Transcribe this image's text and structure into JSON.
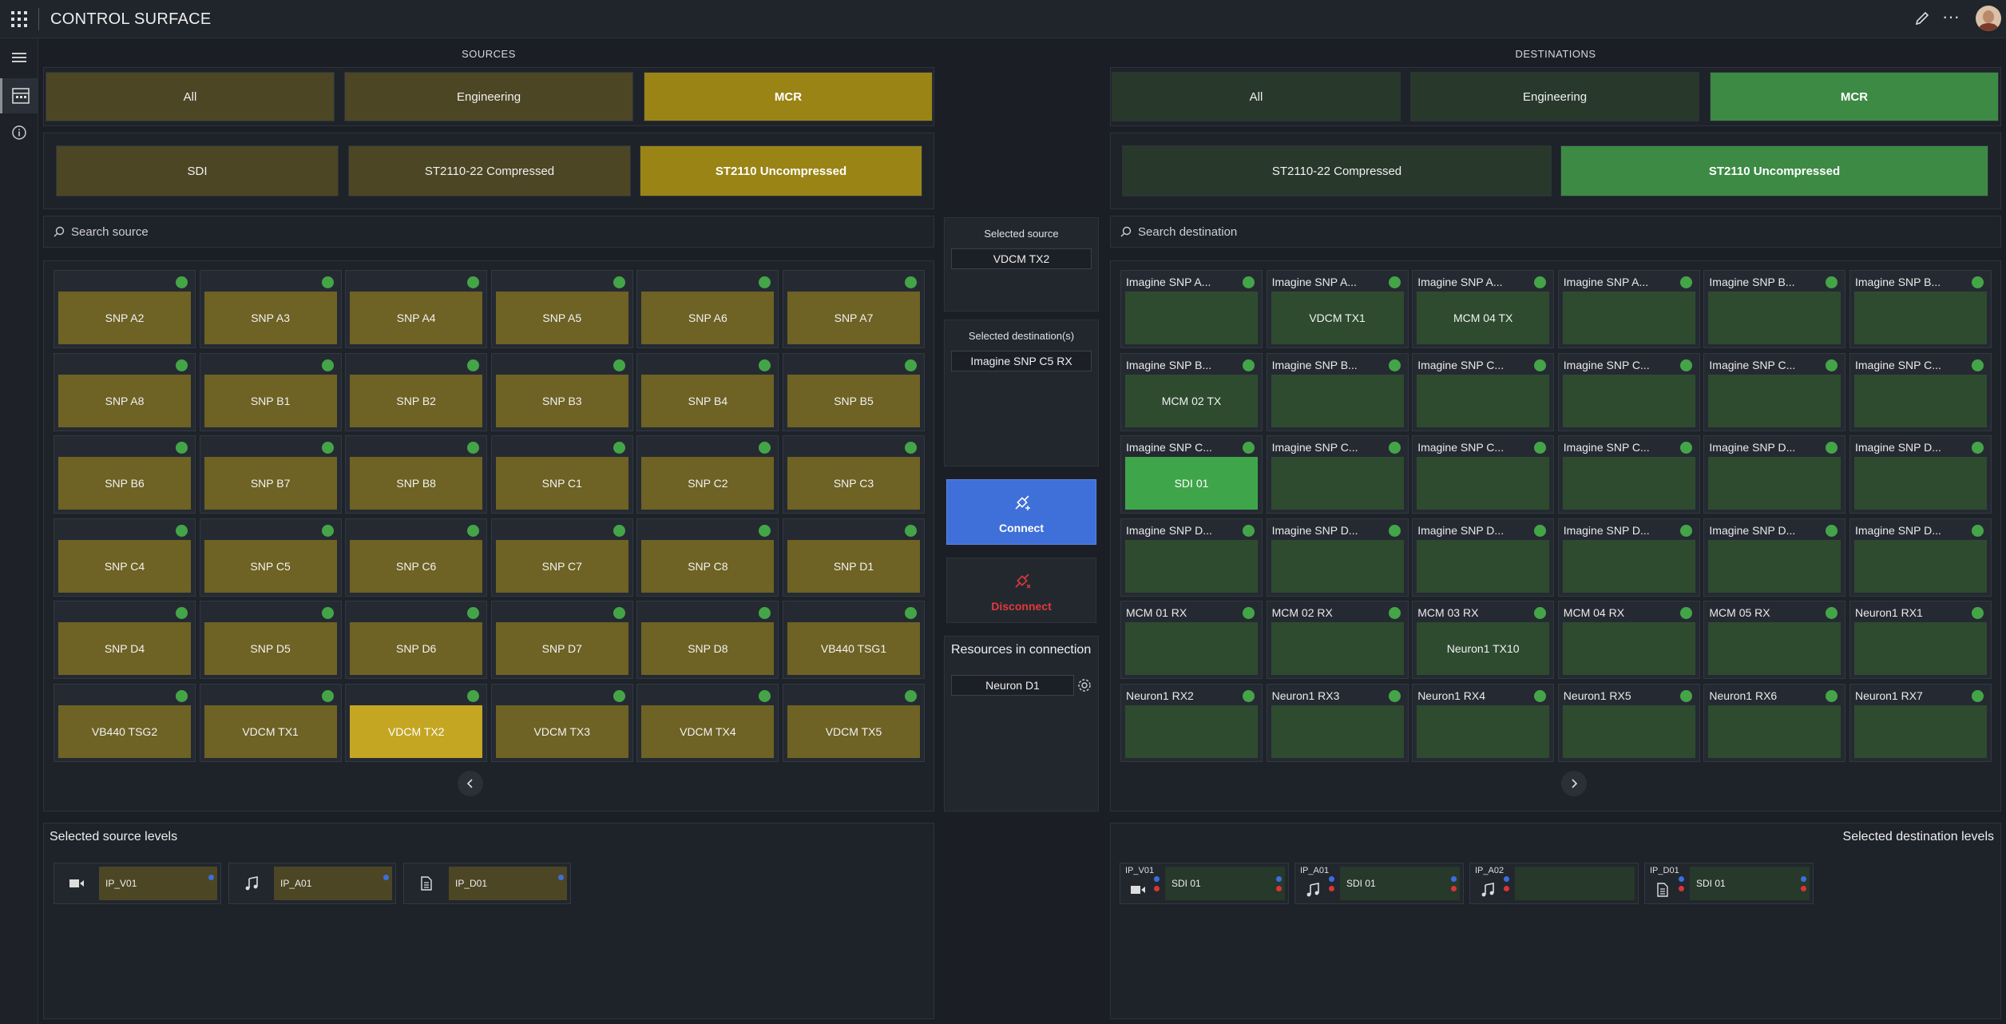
{
  "app": {
    "title": "CONTROL SURFACE"
  },
  "sections": {
    "sources": "SOURCES",
    "destinations": "DESTINATIONS"
  },
  "sources": {
    "groups": [
      "All",
      "Engineering",
      "MCR"
    ],
    "types": [
      "SDI",
      "ST2110-22 Compressed",
      "ST2110 Uncompressed"
    ],
    "search_placeholder": "Search source",
    "tiles": [
      "SNP A2",
      "SNP A3",
      "SNP A4",
      "SNP A5",
      "SNP A6",
      "SNP A7",
      "SNP A8",
      "SNP B1",
      "SNP B2",
      "SNP B3",
      "SNP B4",
      "SNP B5",
      "SNP B6",
      "SNP B7",
      "SNP B8",
      "SNP C1",
      "SNP C2",
      "SNP C3",
      "SNP C4",
      "SNP C5",
      "SNP C6",
      "SNP C7",
      "SNP C8",
      "SNP D1",
      "SNP D4",
      "SNP D5",
      "SNP D6",
      "SNP D7",
      "SNP D8",
      "VB440 TSG1",
      "VB440 TSG2",
      "VDCM TX1",
      "VDCM TX2",
      "VDCM TX3",
      "VDCM TX4",
      "VDCM TX5"
    ]
  },
  "destinations": {
    "groups": [
      "All",
      "Engineering",
      "MCR"
    ],
    "types": [
      "ST2110-22 Compressed",
      "ST2110 Uncompressed"
    ],
    "search_placeholder": "Search destination",
    "tiles": [
      {
        "name": "Imagine SNP A...",
        "value": ""
      },
      {
        "name": "Imagine SNP A...",
        "value": "VDCM TX1"
      },
      {
        "name": "Imagine SNP A...",
        "value": "MCM 04 TX"
      },
      {
        "name": "Imagine SNP A...",
        "value": ""
      },
      {
        "name": "Imagine SNP B...",
        "value": ""
      },
      {
        "name": "Imagine SNP B...",
        "value": ""
      },
      {
        "name": "Imagine SNP B...",
        "value": "MCM 02 TX"
      },
      {
        "name": "Imagine SNP B...",
        "value": ""
      },
      {
        "name": "Imagine SNP C...",
        "value": ""
      },
      {
        "name": "Imagine SNP C...",
        "value": ""
      },
      {
        "name": "Imagine SNP C...",
        "value": ""
      },
      {
        "name": "Imagine SNP C...",
        "value": ""
      },
      {
        "name": "Imagine SNP C...",
        "value": "SDI 01"
      },
      {
        "name": "Imagine SNP C...",
        "value": ""
      },
      {
        "name": "Imagine SNP C...",
        "value": ""
      },
      {
        "name": "Imagine SNP C...",
        "value": ""
      },
      {
        "name": "Imagine SNP D...",
        "value": ""
      },
      {
        "name": "Imagine SNP D...",
        "value": ""
      },
      {
        "name": "Imagine SNP D...",
        "value": ""
      },
      {
        "name": "Imagine SNP D...",
        "value": ""
      },
      {
        "name": "Imagine SNP D...",
        "value": ""
      },
      {
        "name": "Imagine SNP D...",
        "value": ""
      },
      {
        "name": "Imagine SNP D...",
        "value": ""
      },
      {
        "name": "Imagine SNP D...",
        "value": ""
      },
      {
        "name": "MCM 01 RX",
        "value": ""
      },
      {
        "name": "MCM 02 RX",
        "value": ""
      },
      {
        "name": "MCM 03 RX",
        "value": "Neuron1 TX10"
      },
      {
        "name": "MCM 04 RX",
        "value": ""
      },
      {
        "name": "MCM 05 RX",
        "value": ""
      },
      {
        "name": "Neuron1 RX1",
        "value": ""
      },
      {
        "name": "Neuron1 RX2",
        "value": ""
      },
      {
        "name": "Neuron1 RX3",
        "value": ""
      },
      {
        "name": "Neuron1 RX4",
        "value": ""
      },
      {
        "name": "Neuron1 RX5",
        "value": ""
      },
      {
        "name": "Neuron1 RX6",
        "value": ""
      },
      {
        "name": "Neuron1 RX7",
        "value": ""
      }
    ]
  },
  "middle": {
    "selected_source_label": "Selected source",
    "selected_source": "VDCM TX2",
    "selected_destination_label": "Selected destination(s)",
    "selected_destination": "Imagine SNP C5 RX",
    "connect": "Connect",
    "disconnect": "Disconnect",
    "resources_label": "Resources in connection",
    "resource": "Neuron D1"
  },
  "source_levels": {
    "title": "Selected source levels",
    "items": [
      {
        "icon": "video-camera-icon",
        "label": "IP_V01"
      },
      {
        "icon": "music-note-icon",
        "label": "IP_A01"
      },
      {
        "icon": "document-icon",
        "label": "IP_D01"
      }
    ]
  },
  "destination_levels": {
    "title": "Selected destination levels",
    "items": [
      {
        "tag": "IP_V01",
        "icon": "video-camera-icon",
        "value": "SDI 01"
      },
      {
        "tag": "IP_A01",
        "icon": "music-note-icon",
        "value": "SDI 01"
      },
      {
        "tag": "IP_A02",
        "icon": "music-note-icon",
        "value": ""
      },
      {
        "tag": "IP_D01",
        "icon": "document-icon",
        "value": "SDI 01"
      }
    ]
  },
  "colors": {
    "source_accent": "#c4a623",
    "destination_accent": "#3fa54a",
    "connect": "#3f6fd8",
    "disconnect_text": "#e03a3a",
    "status_ok": "#44a548"
  }
}
